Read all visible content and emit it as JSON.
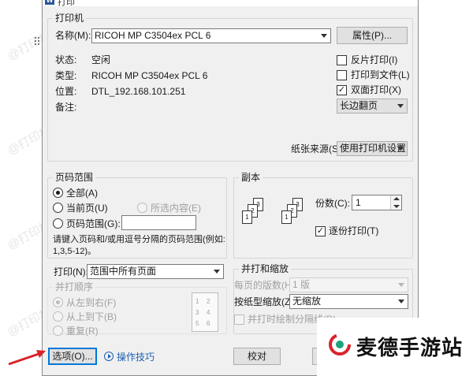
{
  "window": {
    "title": "打印"
  },
  "printer": {
    "group_label": "打印机",
    "name_label": "名称(M):",
    "name_value": "RICOH MP C3504ex PCL 6",
    "properties_button": "属性(P)...",
    "status_label": "状态:",
    "status_value": "空闲",
    "type_label": "类型:",
    "type_value": "RICOH MP C3504ex PCL 6",
    "where_label": "位置:",
    "where_value": "DTL_192.168.101.251",
    "comment_label": "备注:",
    "reverse_print": {
      "label": "反片打印(I)",
      "checked": false
    },
    "print_to_file": {
      "label": "打印到文件(L)",
      "checked": false
    },
    "duplex": {
      "label": "双面打印(X)",
      "checked": true
    },
    "duplex_mode": "长边翻页",
    "paper_source_label": "纸张来源(S):",
    "paper_source_value": "使用打印机设置"
  },
  "page_range": {
    "group_label": "页码范围",
    "all": "全部(A)",
    "current": "当前页(U)",
    "selection": "所选内容(E)",
    "pages": "页码范围(G):",
    "pages_value": "",
    "hint": "请键入页码和/或用逗号分隔的页码范围(例如:",
    "hint_example": "1,3,5-12)。",
    "selected": "all"
  },
  "copies": {
    "group_label": "副本",
    "count_label": "份数(C):",
    "count_value": "1",
    "collate": {
      "label": "逐份打印(T)",
      "checked": true
    },
    "pages_front": [
      "3",
      "2",
      "1"
    ],
    "pages_back": [
      "3",
      "2",
      "1"
    ]
  },
  "print_what": {
    "label": "打印(N):",
    "value": "范围中所有页面"
  },
  "print_order": {
    "group_label": "并打顺序",
    "left_to_right": "从左到右(F)",
    "top_to_bottom": "从上到下(B)",
    "repeat": "重复(R)",
    "preview": [
      "1",
      "2",
      "3",
      "4",
      "5",
      "6"
    ]
  },
  "zoom": {
    "group_label": "并打和缩放",
    "pages_per_sheet_label": "每页的版数(H):",
    "pages_per_sheet_value": "1 版",
    "scale_label": "按纸型缩放(Z):",
    "scale_value": "无缩放",
    "draw_borders": "并打时绘制分隔线(D)"
  },
  "footer": {
    "options_button": "选项(O)...",
    "tips_link": "操作技巧",
    "proofread_button": "校对"
  },
  "brand": {
    "text": "麦德手游站"
  },
  "watermark": {
    "text": "@打印机卫士"
  },
  "colors": {
    "accent": "#0078d7",
    "arrow": "#d9242b",
    "link": "#1e5fb4"
  }
}
